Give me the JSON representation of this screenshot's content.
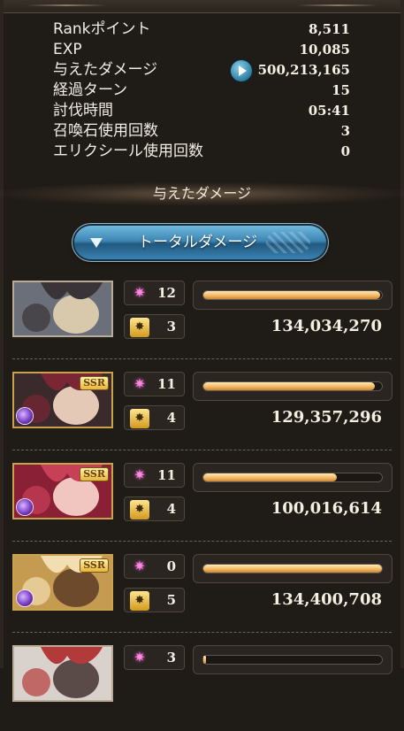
{
  "stats": [
    {
      "label": "Rankポイント",
      "value": "8,511"
    },
    {
      "label": "EXP",
      "value": "10,085"
    },
    {
      "label": "与えたダメージ",
      "value": "500,213,165",
      "has_play_icon": true
    },
    {
      "label": "経過ターン",
      "value": "15"
    },
    {
      "label": "討伐時間",
      "value": "05:41"
    },
    {
      "label": "召喚石使用回数",
      "value": "3"
    },
    {
      "label": "エリクシール使用回数",
      "value": "0"
    }
  ],
  "section_title": "与えたダメージ",
  "total_button": {
    "label": "トータルダメージ"
  },
  "characters": [
    {
      "name": "main-character",
      "ssr": false,
      "element_icon": false,
      "stars": "12",
      "ougi": "3",
      "gauge": 0.98,
      "damage": "134,034,270",
      "colors": [
        "#6b6f79",
        "#d8c9ad",
        "#3a3438"
      ]
    },
    {
      "name": "character-2",
      "ssr": true,
      "ssr_label": "SSR",
      "element_icon": true,
      "stars": "11",
      "ougi": "4",
      "gauge": 0.95,
      "damage": "129,357,296",
      "colors": [
        "#3a2a2c",
        "#e4c9b6",
        "#7a2634"
      ]
    },
    {
      "name": "character-3",
      "ssr": true,
      "ssr_label": "SSR",
      "element_icon": true,
      "stars": "11",
      "ougi": "4",
      "gauge": 0.74,
      "damage": "100,016,614",
      "colors": [
        "#8a2036",
        "#f1c5c0",
        "#c84058"
      ]
    },
    {
      "name": "character-4",
      "ssr": true,
      "ssr_label": "SSR",
      "element_icon": true,
      "stars": "0",
      "ougi": "5",
      "gauge": 0.99,
      "damage": "134,400,708",
      "colors": [
        "#c59b52",
        "#6e4a2c",
        "#f2deb0"
      ]
    },
    {
      "name": "character-5",
      "ssr": false,
      "element_icon": false,
      "stars": "3",
      "ougi": "",
      "gauge": 0.01,
      "damage": "",
      "colors": [
        "#d9d2cc",
        "#5a4a48",
        "#b33a3a"
      ]
    }
  ],
  "icons": {
    "star": "sparkle-icon",
    "ougi": "ougi-icon",
    "play": "play-icon",
    "element": "dark-element-icon"
  },
  "glyphs": {
    "star": "✷",
    "ougi": "✸"
  }
}
